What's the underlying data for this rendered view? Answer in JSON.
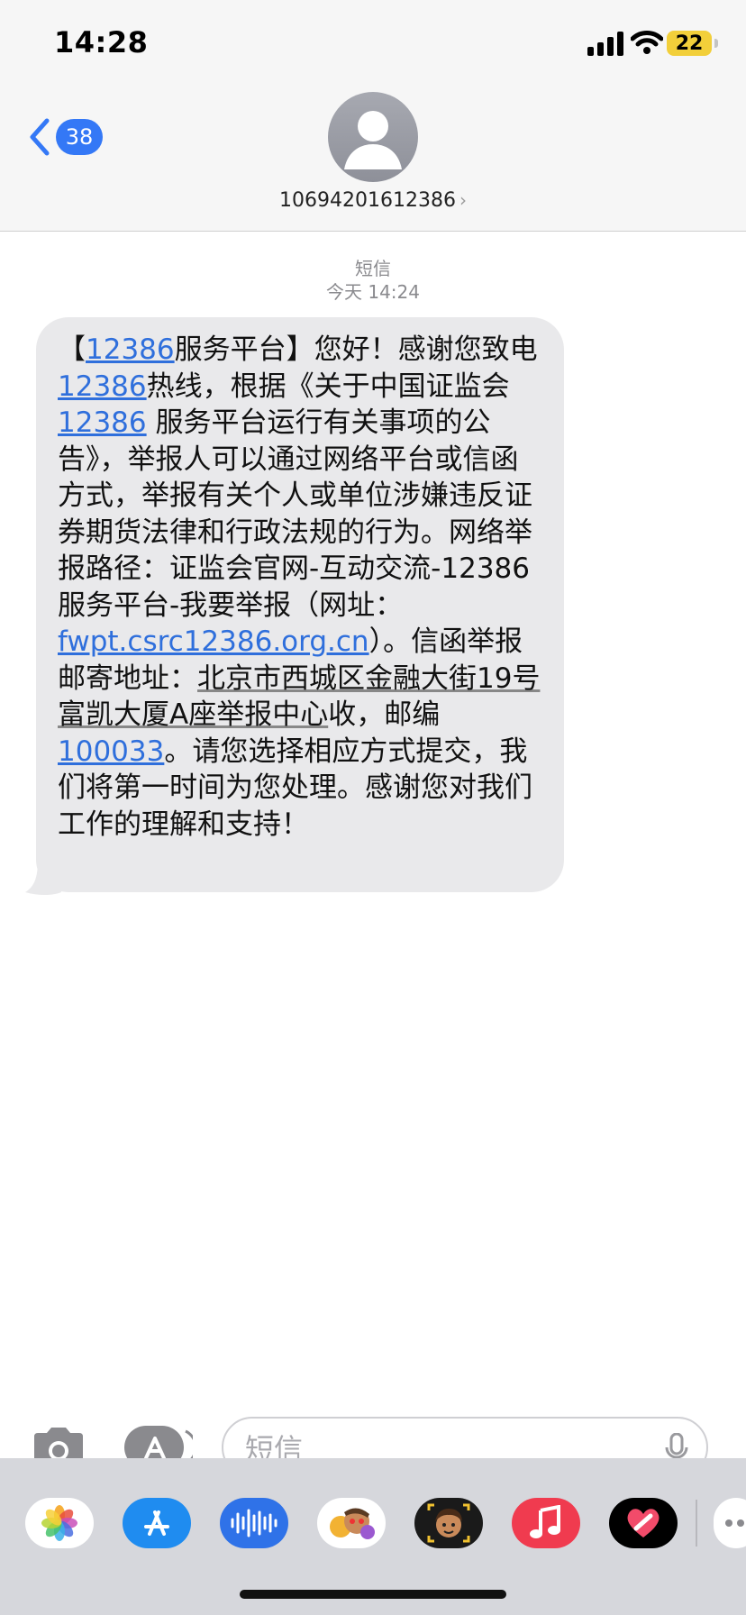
{
  "status": {
    "time": "14:28",
    "battery": "22"
  },
  "nav": {
    "back_count": "38",
    "contact": "10694201612386",
    "contact_chevron": "›"
  },
  "thread": {
    "service": "短信",
    "timestamp": "今天 14:24"
  },
  "message": {
    "p1": "【",
    "link1": "12386",
    "p2": "服务平台】您好！感谢您致电",
    "link2": "12386",
    "p3": "热线，根据《关于中国证监会 ",
    "link3": "12386",
    "p4": " 服务平台运行有关事项的公告》，举报人可以通过网络平台或信函方式，举报有关个人或单位涉嫌违反证券期货法律和行政法规的行为。网络举报路径：证监会官网-互动交流-12386服务平台-我要举报（网址：",
    "link4": "fwpt.csrc12386.org.cn",
    "p5": "）。信函举报邮寄地址：",
    "address": "北京市西城区金融大街19号富凯大厦A座举报中心",
    "p6": "收，邮编",
    "link5": "100033",
    "p7": "。请您选择相应方式提交，我们将第一时间为您处理。感谢您对我们工作的理解和支持！"
  },
  "composer": {
    "placeholder": "短信"
  },
  "colors": {
    "accent": "#3478f6",
    "bubble": "#e9e9eb",
    "battery": "#f2cf3a",
    "link": "#2f6fdc"
  },
  "icons": [
    "signal-icon",
    "wifi-icon",
    "back-chevron-icon",
    "avatar-icon",
    "camera-icon",
    "apps-icon",
    "mic-icon",
    "photos-app-icon",
    "app-store-app-icon",
    "audio-message-app-icon",
    "memoji-stickers-app-icon",
    "memoji-app-icon",
    "music-app-icon",
    "digital-touch-app-icon",
    "more-apps-icon"
  ]
}
